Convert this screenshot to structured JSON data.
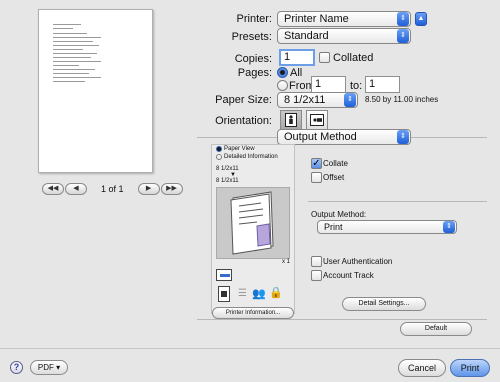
{
  "preview": {
    "page_indicator": "1 of 1"
  },
  "printer": {
    "label": "Printer:",
    "value": "Printer Name"
  },
  "presets": {
    "label": "Presets:",
    "value": "Standard"
  },
  "copies": {
    "label": "Copies:",
    "value": "1",
    "collated_label": "Collated"
  },
  "pages": {
    "label": "Pages:",
    "all_label": "All",
    "from_label": "From:",
    "from_value": "1",
    "to_label": "to:",
    "to_value": "1"
  },
  "paper_size": {
    "label": "Paper Size:",
    "value": "8 1/2x11",
    "dimensions": "8.50 by 11.00 inches"
  },
  "orientation": {
    "label": "Orientation:"
  },
  "section_popup": {
    "value": "Output Method"
  },
  "view_options": {
    "paper_view": "Paper View",
    "detailed_info": "Detailed Information"
  },
  "paper_info": {
    "line1": "8 1/2x11",
    "arrow": "▼",
    "line2": "8 1/2x11",
    "quantity": "x 1"
  },
  "printer_info_button": "Printer Information...",
  "collate_label": "Collate",
  "offset_label": "Offset",
  "output_method": {
    "label": "Output Method:",
    "value": "Print"
  },
  "user_auth_label": "User Authentication",
  "account_track_label": "Account Track",
  "detail_settings_button": "Detail Settings...",
  "default_button": "Default",
  "bottom": {
    "help": "?",
    "pdf": "PDF ▾",
    "cancel": "Cancel",
    "print": "Print"
  }
}
